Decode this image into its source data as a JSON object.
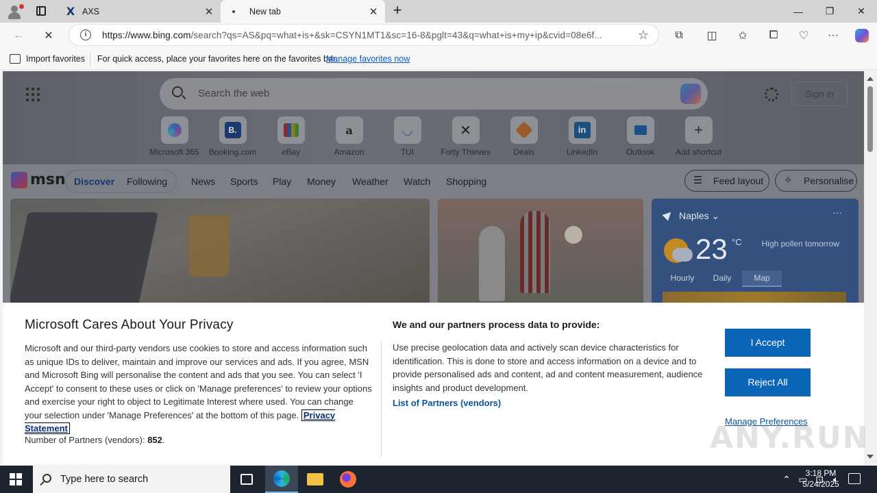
{
  "browser": {
    "tabs": [
      {
        "title": "AXS",
        "favicon": "axs-logo",
        "active": false
      },
      {
        "title": "New tab",
        "favicon": "loading-dot",
        "active": true
      }
    ],
    "url_host": "https://www.bing.com",
    "url_rest": "/search?qs=AS&pq=what+is+&sk=CSYN1MT1&sc=16-8&pglt=43&q=what+is+my+ip&cvid=08e6f...",
    "favorites": {
      "import_label": "Import favorites",
      "message": "For quick access, place your favorites here on the favorites bar.",
      "manage_link": "Manage favorites now"
    }
  },
  "msn_page": {
    "search_placeholder": "Search the web",
    "sign_in": "Sign in",
    "shortcuts": [
      {
        "label": "Microsoft 365",
        "icon": "m365-icon"
      },
      {
        "label": "Booking.com",
        "icon": "booking-icon"
      },
      {
        "label": "eBay",
        "icon": "ebay-icon"
      },
      {
        "label": "Amazon",
        "icon": "amazon-icon"
      },
      {
        "label": "TUI",
        "icon": "tui-icon"
      },
      {
        "label": "Forty Thieves",
        "icon": "forty-thieves-icon"
      },
      {
        "label": "Deals",
        "icon": "deals-icon"
      },
      {
        "label": "LinkedIn",
        "icon": "linkedin-icon"
      },
      {
        "label": "Outlook",
        "icon": "outlook-icon"
      },
      {
        "label": "Add shortcut",
        "icon": "plus-icon"
      }
    ],
    "logo_text": "msn",
    "nav": [
      "Discover",
      "Following",
      "News",
      "Sports",
      "Play",
      "Money",
      "Weather",
      "Watch",
      "Shopping"
    ],
    "feed_layout": "Feed layout",
    "personalise": "Personalise",
    "weather": {
      "location": "Naples",
      "temp": "23",
      "unit": "°C",
      "pollen": "High pollen tomorrow",
      "tabs": [
        "Hourly",
        "Daily",
        "Map"
      ],
      "selected_tab": "Map"
    }
  },
  "privacy": {
    "title": "Microsoft Cares About Your Privacy",
    "body": "Microsoft and our third-party vendors use cookies to store and access information such as unique IDs to deliver, maintain and improve our services and ads. If you agree, MSN and Microsoft Bing will personalise the content and ads that you see. You can select 'I Accept' to consent to these uses or click on 'Manage preferences' to review your options and exercise your right to object to Legitimate Interest where used.  You can change your selection under 'Manage Preferences' at the bottom of this page.",
    "privacy_link": "Privacy Statement",
    "partners_label": "Number of Partners (vendors):",
    "partners_count": "852",
    "partners_suffix": ".",
    "purposes_title": "We and our partners process data to provide:",
    "purposes_text": "Use precise geolocation data and actively scan device characteristics for identification. This is done to store and access information on a device and to provide personalised ads and content, ad and content measurement, audience insights and product development.",
    "vendors_link": "List of Partners (vendors)",
    "accept": "I Accept",
    "reject": "Reject All",
    "manage": "Manage Preferences"
  },
  "watermark": "ANY.RUN",
  "taskbar": {
    "search_placeholder": "Type here to search",
    "time": "3:18 PM",
    "date": "5/24/2025"
  }
}
